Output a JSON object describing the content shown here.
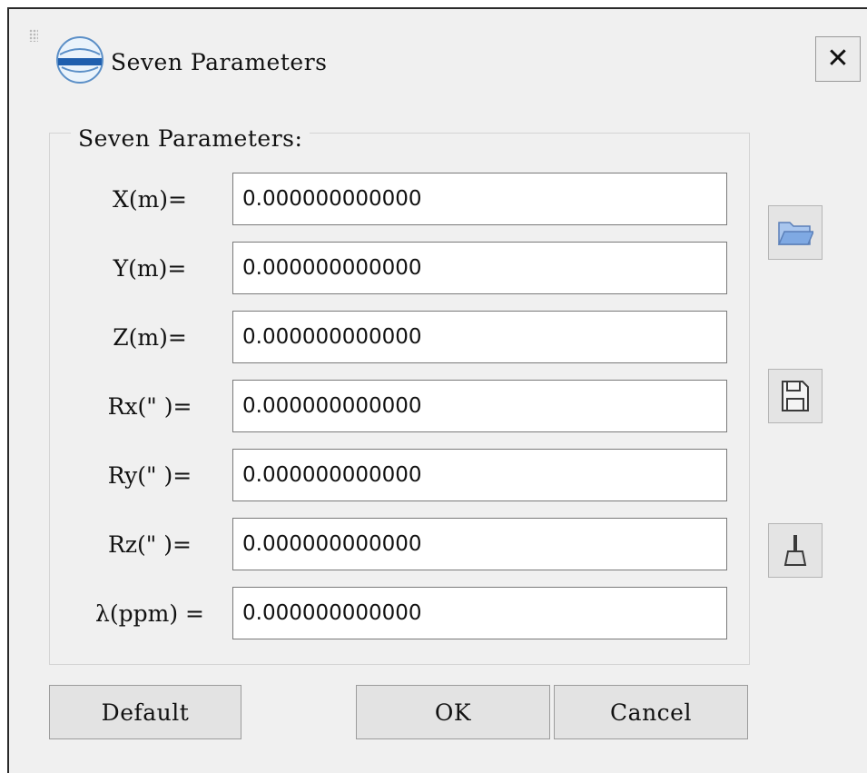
{
  "window": {
    "title": "Seven Parameters",
    "close_icon": "close-x-icon",
    "app_icon": "globe-logo-icon"
  },
  "group": {
    "label": "Seven Parameters:"
  },
  "parameters": [
    {
      "label": "X(m)=",
      "value": "0.000000000000"
    },
    {
      "label": "Y(m)=",
      "value": "0.000000000000"
    },
    {
      "label": "Z(m)=",
      "value": "0.000000000000"
    },
    {
      "label": "Rx(\" )=",
      "value": "0.000000000000"
    },
    {
      "label": "Ry(\" )=",
      "value": "0.000000000000"
    },
    {
      "label": "Rz(\" )=",
      "value": "0.000000000000"
    },
    {
      "label": "λ(ppm) =",
      "value": "0.000000000000"
    }
  ],
  "side_buttons": {
    "open_icon": "folder-open-icon",
    "save_icon": "floppy-save-icon",
    "clear_icon": "broom-clear-icon"
  },
  "buttons": {
    "default_label": "Default",
    "ok_label": "OK",
    "cancel_label": "Cancel"
  },
  "colors": {
    "window_bg": "#f0f0f0",
    "input_bg": "#ffffff",
    "button_bg": "#e3e3e3",
    "folder_blue": "#7fa9e3"
  }
}
